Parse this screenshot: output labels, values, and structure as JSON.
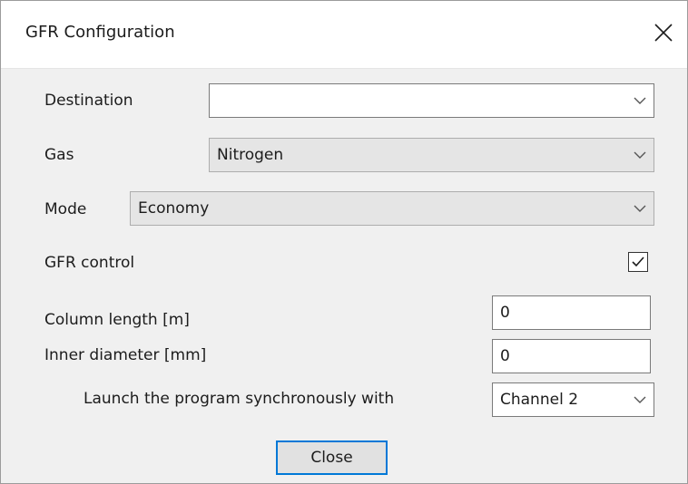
{
  "window": {
    "title": "GFR Configuration",
    "close_icon": "close-icon"
  },
  "form": {
    "destination": {
      "label": "Destination",
      "value": ""
    },
    "gas": {
      "label": "Gas",
      "value": "Nitrogen"
    },
    "mode": {
      "label": "Mode",
      "value": "Economy"
    },
    "gfr_control": {
      "label": "GFR control",
      "checked": true
    },
    "column_length": {
      "label": "Column length [m]",
      "value": "0"
    },
    "inner_diameter": {
      "label": "Inner diameter [mm]",
      "value": "0"
    },
    "launch_sync": {
      "label": "Launch the program synchronously with",
      "value": "Channel 2"
    }
  },
  "buttons": {
    "close_label": "Close"
  },
  "colors": {
    "focus_border": "#0078d7",
    "dialog_bg": "#f0f0f0",
    "titlebar_bg": "#ffffff"
  }
}
